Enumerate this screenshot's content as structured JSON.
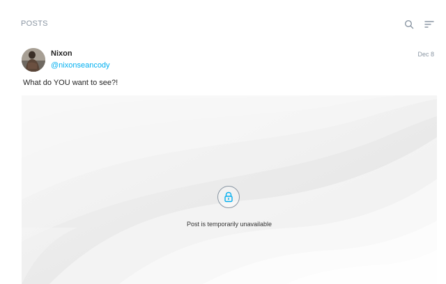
{
  "header": {
    "title": "POSTS",
    "search_icon": "search-icon",
    "sort_icon": "sort-icon"
  },
  "post": {
    "author_name": "Nixon",
    "author_handle": "@nixonseancody",
    "date": "Dec 8",
    "text": "What do YOU want to see?!",
    "media": {
      "lock_icon": "lock-icon",
      "status_text": "Post is temporarily unavailable"
    }
  },
  "colors": {
    "accent": "#00aff0",
    "muted": "#8a96a3",
    "text": "#222222"
  }
}
